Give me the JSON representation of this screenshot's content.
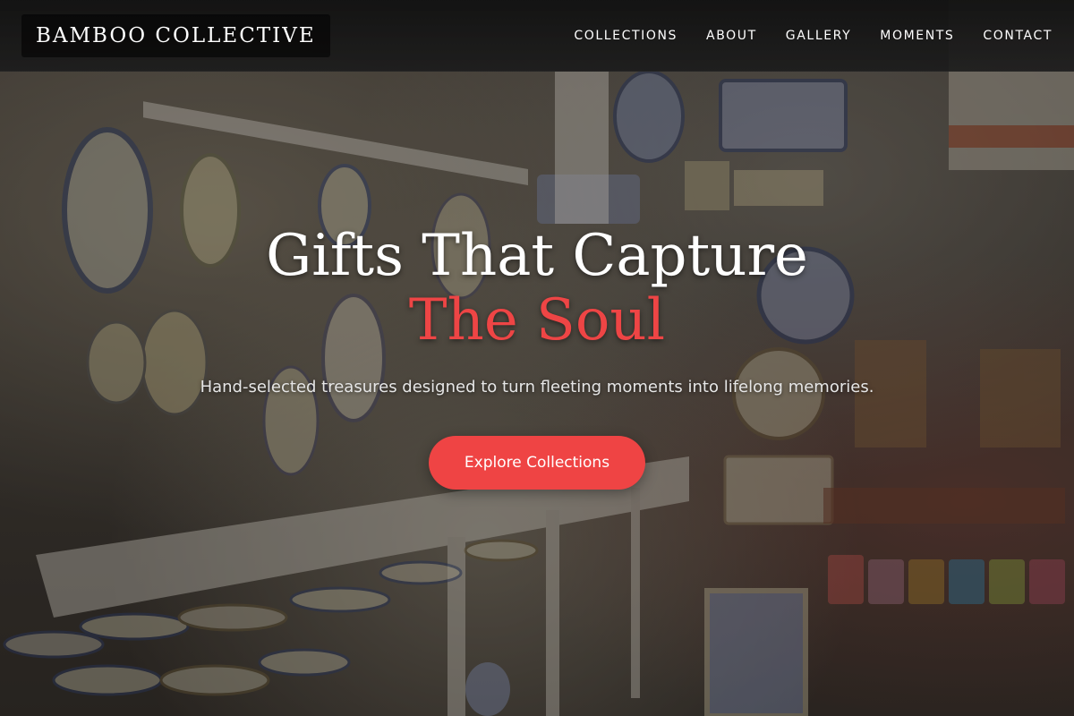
{
  "brand": {
    "name": "BAMBOO COLLECTIVE"
  },
  "nav": {
    "items": [
      {
        "label": "COLLECTIONS"
      },
      {
        "label": "ABOUT"
      },
      {
        "label": "GALLERY"
      },
      {
        "label": "MOMENTS"
      },
      {
        "label": "CONTACT"
      }
    ]
  },
  "hero": {
    "title_line1": "Gifts That Capture",
    "title_line2": "The Soul",
    "subtitle": "Hand-selected treasures designed to turn fleeting moments into lifelong memories.",
    "cta_label": "Explore Collections",
    "background_image": "ceramic-shop-interior"
  },
  "colors": {
    "accent": "#ef4444",
    "header_bg": "#1a1a1a",
    "text": "#ffffff"
  }
}
